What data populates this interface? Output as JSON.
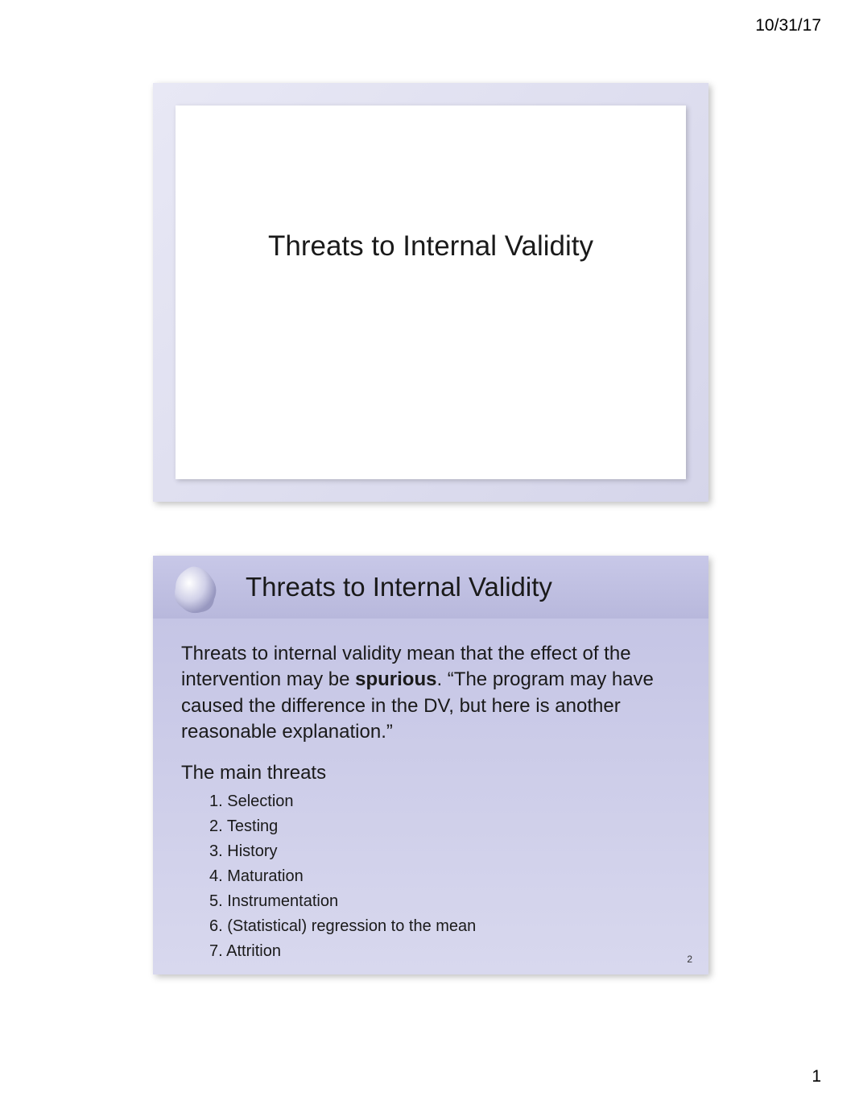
{
  "page": {
    "date": "10/31/17",
    "number": "1"
  },
  "slide1": {
    "title": "Threats to Internal Validity"
  },
  "slide2": {
    "title": "Threats to Internal Validity",
    "paragraph_pre": "Threats to internal validity mean that the effect of the intervention may be ",
    "paragraph_bold": "spurious",
    "paragraph_post": ". “The program may have caused the difference in the DV, but here is another reasonable explanation.”",
    "subhead": "The main threats",
    "threats": [
      "Selection",
      "Testing",
      "History",
      "Maturation",
      "Instrumentation",
      "(Statistical) regression to the mean",
      "Attrition"
    ],
    "slide_number": "2"
  }
}
